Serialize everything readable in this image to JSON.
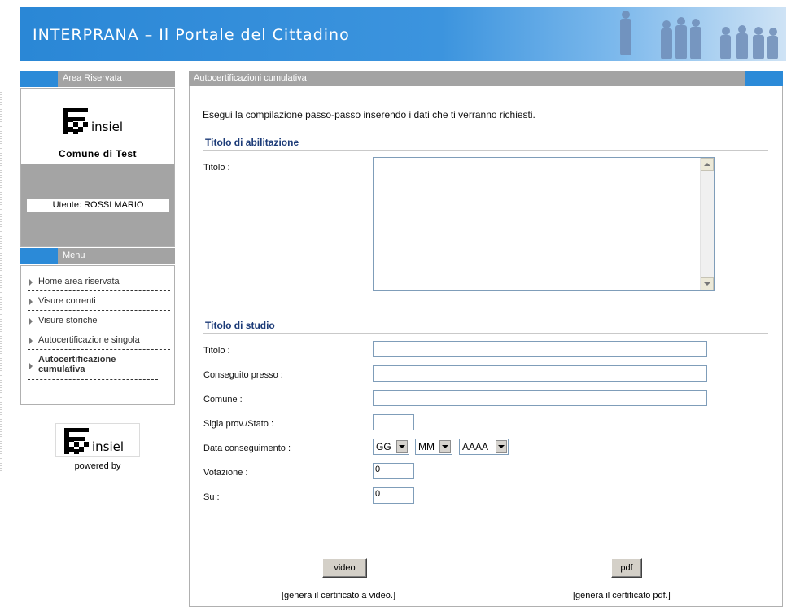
{
  "header": {
    "title": "INTERPRANA – Il Portale del Cittadino"
  },
  "area_riservata": {
    "title": "Area Riservata",
    "logo_text": "insiel",
    "comune": "Comune di Test",
    "utente": "Utente: ROSSI MARIO"
  },
  "menu": {
    "title": "Menu",
    "items": [
      {
        "label": "Home area riservata"
      },
      {
        "label": "Visure correnti"
      },
      {
        "label": "Visure storiche"
      },
      {
        "label": "Autocertificazione singola"
      },
      {
        "label": "Autocertificazione cumulativa"
      }
    ]
  },
  "powered": {
    "logo_text": "insiel",
    "label": "powered by"
  },
  "main": {
    "panel_title": "Autocertificazioni cumulativa",
    "intro": "Esegui la compilazione passo-passo inserendo i dati che ti verranno richiesti.",
    "abilitazione": {
      "title": "Titolo di abilitazione",
      "titolo_label": "Titolo :"
    },
    "studio": {
      "title": "Titolo di studio",
      "titolo_label": "Titolo :",
      "conseguito_label": "Conseguito presso :",
      "comune_label": "Comune :",
      "sigla_label": "Sigla prov./Stato :",
      "data_label": "Data conseguimento :",
      "votazione_label": "Votazione :",
      "votazione_value": "0",
      "su_label": "Su :",
      "su_value": "0",
      "gg": "GG",
      "mm": "MM",
      "aaaa": "AAAA"
    },
    "video_button": "video",
    "pdf_button": "pdf",
    "video_caption": "[genera il certificato a video.]",
    "pdf_caption": "[genera il certificato pdf.]"
  },
  "colors": {
    "accent": "#2b8ad8",
    "bar_grey": "#a3a3a3",
    "section_title": "#1c3b78"
  }
}
